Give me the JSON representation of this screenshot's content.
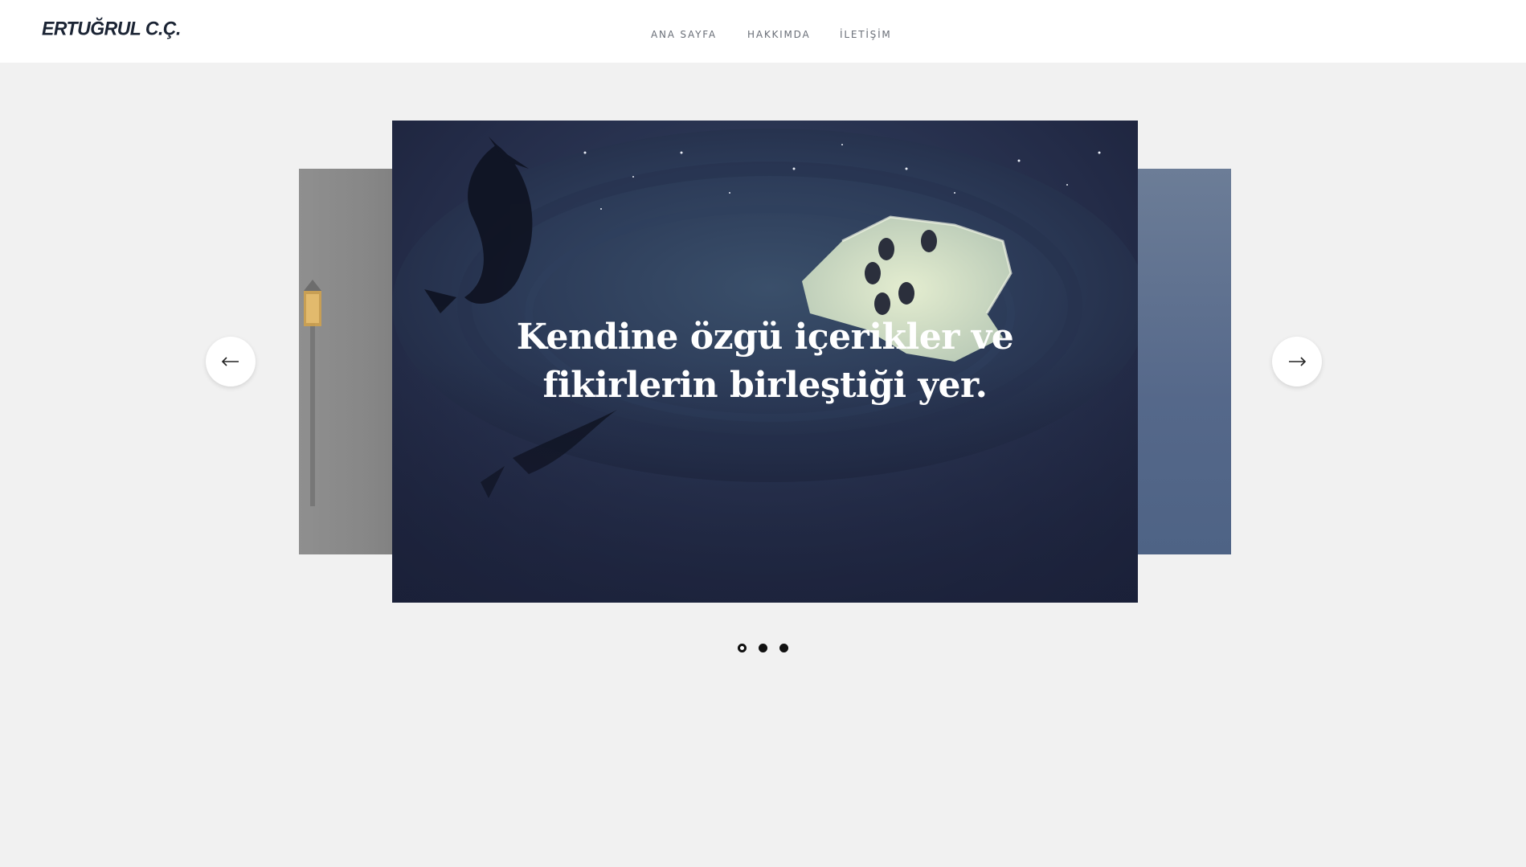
{
  "header": {
    "logo": "ERTUĞRUL C.Ç.",
    "nav": [
      "ANA SAYFA",
      "HAKKIMDA",
      "İLETİŞİM"
    ]
  },
  "slider": {
    "headline_line1": "Kendine özgü içerikler ve",
    "headline_line2": "fikirlerin birleştiği yer.",
    "prev_icon": "arrow-left-icon",
    "next_icon": "arrow-right-icon",
    "slides_count": 3,
    "active_index": 0
  },
  "colors": {
    "page_bg": "#f1f1f1",
    "header_bg": "#ffffff",
    "nav_text": "#6a6f78",
    "headline": "#ffffff"
  }
}
